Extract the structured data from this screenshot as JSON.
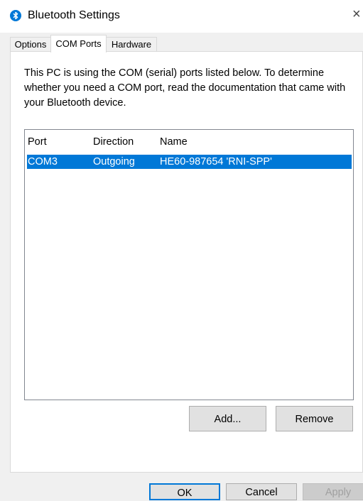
{
  "window": {
    "title": "Bluetooth Settings",
    "close_label": "×",
    "icon": "bluetooth-icon"
  },
  "tabs": [
    {
      "label": "Options"
    },
    {
      "label": "COM Ports",
      "active": true
    },
    {
      "label": "Hardware"
    }
  ],
  "description": "This PC is using the COM (serial) ports listed below. To determine whether you need a COM port, read the documentation that came with your Bluetooth device.",
  "ports_list": {
    "columns": [
      "Port",
      "Direction",
      "Name"
    ],
    "rows": [
      {
        "port": "COM3",
        "direction": "Outgoing",
        "name": "HE60-987654 'RNI-SPP'",
        "selected": true
      }
    ]
  },
  "buttons": {
    "add": "Add...",
    "remove": "Remove",
    "ok": "OK",
    "cancel": "Cancel",
    "apply": "Apply"
  },
  "colors": {
    "selection": "#0078d7",
    "bluetooth": "#0078d7"
  }
}
